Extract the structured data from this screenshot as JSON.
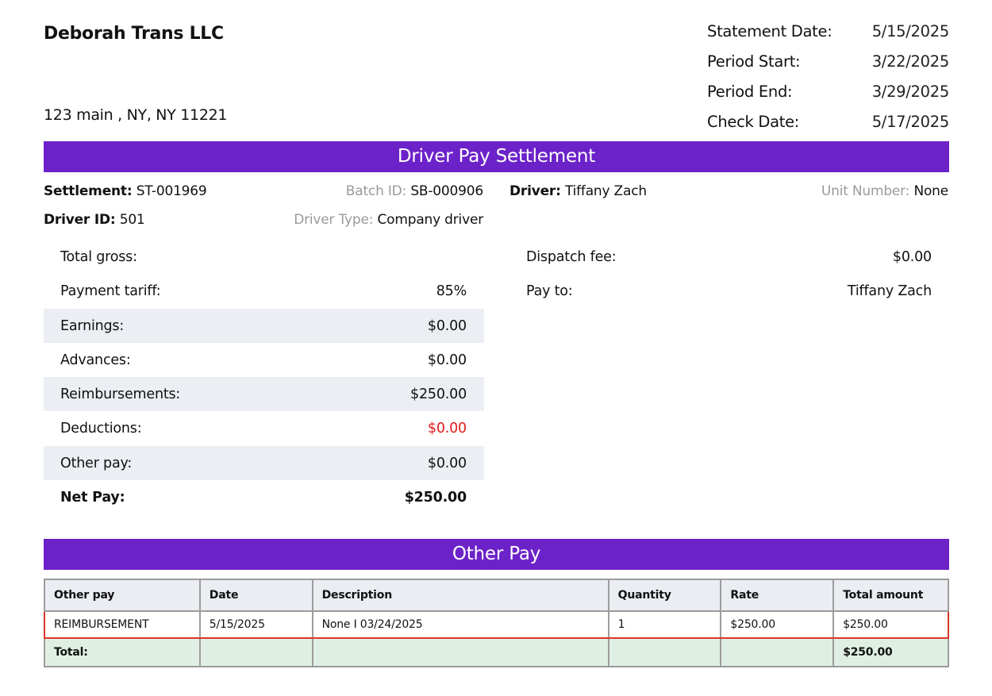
{
  "company": {
    "name": "Deborah Trans LLC",
    "address": "123 main , NY, NY 11221"
  },
  "statement": [
    {
      "label": "Statement Date:",
      "value": "5/15/2025"
    },
    {
      "label": "Period Start:",
      "value": "3/22/2025"
    },
    {
      "label": "Period End:",
      "value": "3/29/2025"
    },
    {
      "label": "Check Date:",
      "value": "5/17/2025"
    }
  ],
  "settlement_banner": "Driver Pay Settlement",
  "info": {
    "settlement_label": "Settlement:",
    "settlement_value": "ST-001969",
    "batch_label": "Batch ID:",
    "batch_value": "SB-000906",
    "driver_label": "Driver:",
    "driver_value": "Tiffany Zach",
    "unit_label": "Unit Number:",
    "unit_value": "None",
    "driver_id_label": "Driver ID:",
    "driver_id_value": "501",
    "driver_type_label": "Driver Type:",
    "driver_type_value": "Company driver"
  },
  "summary": [
    {
      "label": "Total gross:",
      "value": ""
    },
    {
      "label": "Payment tariff:",
      "value": "85%"
    },
    {
      "label": "Earnings:",
      "value": "$0.00"
    },
    {
      "label": "Advances:",
      "value": "$0.00"
    },
    {
      "label": "Reimbursements:",
      "value": "$250.00"
    },
    {
      "label": "Deductions:",
      "value": "$0.00"
    },
    {
      "label": "Other pay:",
      "value": "$0.00"
    },
    {
      "label": "Net Pay:",
      "value": "$250.00"
    }
  ],
  "right_summary": [
    {
      "label": "Dispatch fee:",
      "value": "$0.00"
    },
    {
      "label": "Pay to:",
      "value": "Tiffany Zach"
    }
  ],
  "other_pay_banner": "Other Pay",
  "other_pay_table": {
    "headers": [
      "Other pay",
      "Date",
      "Description",
      "Quantity",
      "Rate",
      "Total amount"
    ],
    "rows": [
      [
        "REIMBURSEMENT",
        "5/15/2025",
        "None I 03/24/2025",
        "1",
        "$250.00",
        "$250.00"
      ]
    ],
    "total_label": "Total:",
    "total_value": "$250.00"
  },
  "colors": {
    "banner": "#6c22c9",
    "deductions": "#e01b1b",
    "highlight_border": "#d9362a",
    "total_row": "#e0efe3"
  }
}
